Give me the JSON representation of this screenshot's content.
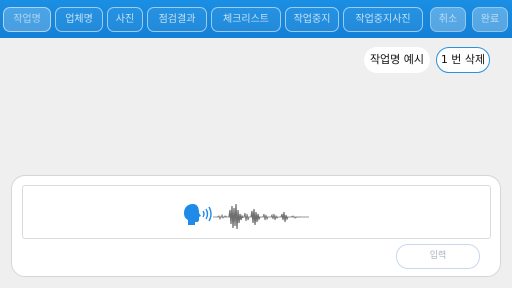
{
  "tabs": [
    {
      "id": "name",
      "label": "작업명",
      "state": "active"
    },
    {
      "id": "company",
      "label": "업체명",
      "state": "normal"
    },
    {
      "id": "photo",
      "label": "사진",
      "state": "normal"
    },
    {
      "id": "inspection",
      "label": "점검결과",
      "state": "normal"
    },
    {
      "id": "checklist",
      "label": "체크리스트",
      "state": "normal"
    },
    {
      "id": "stop",
      "label": "작업중지",
      "state": "normal"
    },
    {
      "id": "stop-photo",
      "label": "작업중지사진",
      "state": "normal"
    }
  ],
  "actions": {
    "cancel_label": "취소",
    "done_label": "완료"
  },
  "chips": {
    "example_label": "작업명 예시",
    "delete_label": "1 번 삭제"
  },
  "input_panel": {
    "icon": "voice-recording-waveform",
    "submit_label": "입력"
  },
  "colors": {
    "accent": "#1a8fe3",
    "background": "#efefef",
    "speaker_icon": "#1f8ae8",
    "waveform": "#7d7d7d"
  }
}
